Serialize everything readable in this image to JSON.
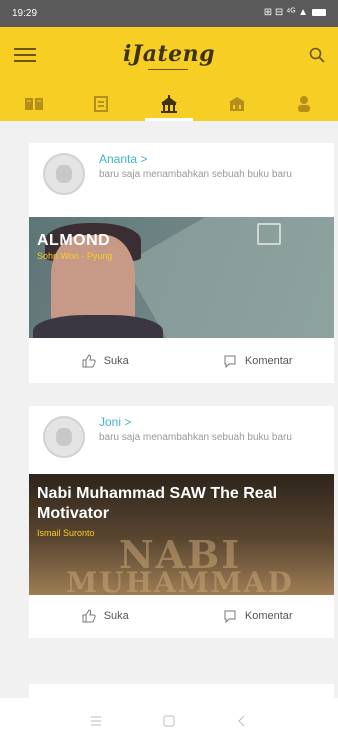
{
  "status_bar": {
    "time": "19:29",
    "indicators": "⊞ ⊟ ⁴ᴳ ▲",
    "icons": [
      "sim-icon",
      "signal-icon",
      "battery-icon"
    ]
  },
  "app": {
    "title": "iJateng",
    "accent": "#f7cf24",
    "link_color": "#3fb3c9"
  },
  "tabs": [
    {
      "id": "books",
      "icon": "books-icon",
      "active": false
    },
    {
      "id": "reader",
      "icon": "reader-icon",
      "active": false
    },
    {
      "id": "library",
      "icon": "library-icon",
      "active": true
    },
    {
      "id": "institution",
      "icon": "building-icon",
      "active": false
    },
    {
      "id": "profile",
      "icon": "person-icon",
      "active": false
    }
  ],
  "feed": [
    {
      "user": "Ananta >",
      "activity": "baru saja menambahkan sebuah buku baru",
      "cover_title": "ALMOND",
      "cover_subtitle": "Sohn Won - Pyung",
      "like_label": "Suka",
      "comment_label": "Komentar"
    },
    {
      "user": "Joni >",
      "activity": "baru saja menambahkan sebuah buku baru",
      "cover_title": "Nabi Muhammad SAW The Real Motivator",
      "cover_subtitle": "Ismail Suronto",
      "cover_art_text_1": "NABI",
      "cover_art_text_2": "MUHAMMAD",
      "like_label": "Suka",
      "comment_label": "Komentar"
    }
  ],
  "nav": [
    "menu-lines-icon",
    "home-square-icon",
    "back-icon"
  ]
}
